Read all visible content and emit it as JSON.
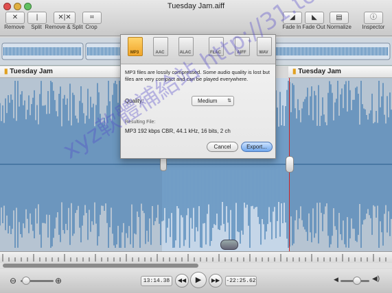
{
  "window": {
    "title": "Tuesday Jam.aiff"
  },
  "toolbar": {
    "remove": "Remove",
    "split": "Split",
    "remove_split": "Remove & Split",
    "crop": "Crop",
    "fade_in": "Fade In",
    "fade_out": "Fade Out",
    "normalize": "Normalize",
    "inspector": "Inspector"
  },
  "tracks": {
    "left_name": "Tuesday Jam",
    "right_name": "Tuesday Jam"
  },
  "export_sheet": {
    "formats": [
      "MP3",
      "AAC",
      "ALAC",
      "FLAC",
      "AIFF",
      "WAV"
    ],
    "selected_format": "MP3",
    "description": "MP3 files are lossily compressed. Some audio quality is lost but files are very compact and can be played everywhere.",
    "quality_label": "Quality:",
    "quality_value": "Medium",
    "resulting_label": "Resulting File:",
    "resulting_value": "MP3 192 kbps CBR, 44.1 kHz, 16 bits, 2 ch",
    "cancel": "Cancel",
    "export": "Export..."
  },
  "transport": {
    "current_time": "13:14.38",
    "remaining_time": "-22:25.62"
  },
  "watermark": "xyz軟體補給站 http://31.to",
  "colors": {
    "waveform": "#3a78b0",
    "selection": "#d2e6fa",
    "accent": "#f0a52a",
    "playhead": "#d02020"
  }
}
